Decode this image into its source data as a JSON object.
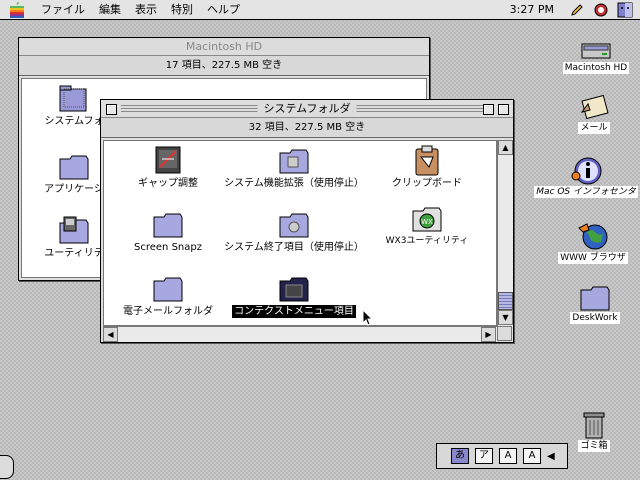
{
  "menubar": {
    "menus": [
      "ファイル",
      "編集",
      "表示",
      "特別",
      "ヘルプ"
    ],
    "clock": "3:27 PM"
  },
  "back_window": {
    "title": "Macintosh HD",
    "info": "17 項目、227.5 MB 空き",
    "items": [
      "システムフォ",
      "アプリケーシ",
      "ユーティリテ"
    ]
  },
  "front_window": {
    "title": "システムフォルダ",
    "info": "32 項目、227.5 MB 空き",
    "items": [
      {
        "label": "ギャップ調整",
        "icon": "monitor-gap-icon"
      },
      {
        "label": "システム機能拡張（使用停止）",
        "icon": "folder-icon"
      },
      {
        "label": "クリップボード",
        "icon": "clipboard-icon"
      },
      {
        "label": "Screen Snapz",
        "icon": "folder-icon"
      },
      {
        "label": "システム終了項目（使用停止）",
        "icon": "folder-icon"
      },
      {
        "label": "WX3ユーティリティ",
        "icon": "wx3-icon"
      },
      {
        "label": "電子メールフォルダ",
        "icon": "folder-icon"
      },
      {
        "label": "コンテクストメニュー項目",
        "icon": "dark-folder-icon"
      }
    ]
  },
  "desktop": {
    "icons": [
      {
        "label": "Macintosh HD",
        "icon": "hard-drive-icon"
      },
      {
        "label": "メール",
        "icon": "mail-icon"
      },
      {
        "label": "Mac OS インフォセンタ",
        "icon": "info-icon"
      },
      {
        "label": "WWW ブラウザ",
        "icon": "globe-icon"
      },
      {
        "label": "DeskWork",
        "icon": "folder-icon"
      },
      {
        "label": "ゴミ箱",
        "icon": "trash-icon"
      }
    ]
  },
  "palette": {
    "buttons": [
      "あ",
      "ア",
      "A",
      "A"
    ]
  }
}
